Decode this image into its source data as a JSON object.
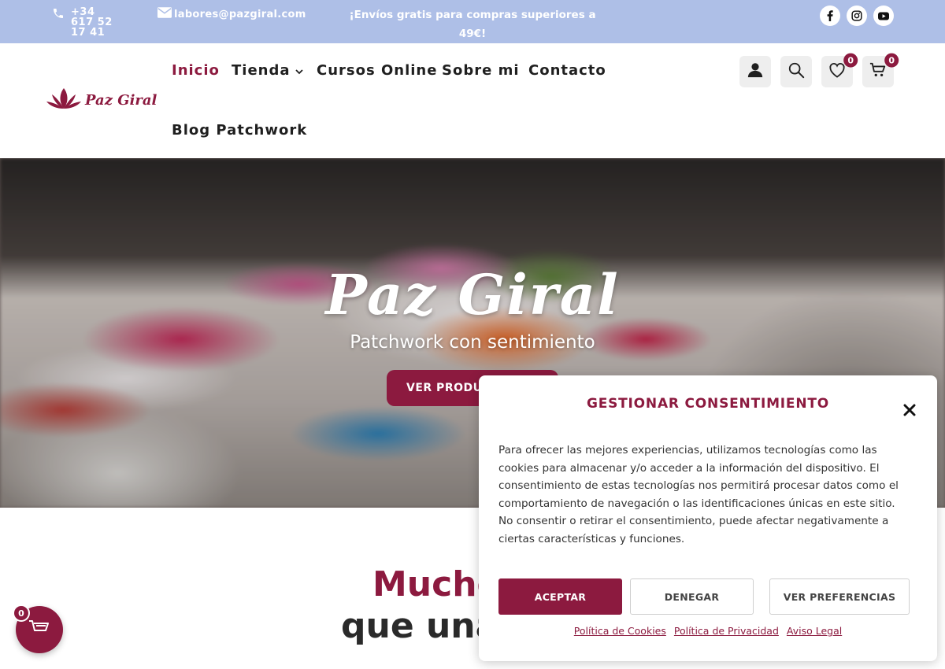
{
  "topbar": {
    "phone": "+34 617 52 17 41",
    "email": "labores@pazgiral.com",
    "promo": "¡Envíos gratis para compras superiores a 49€!",
    "social": [
      "facebook-icon",
      "instagram-icon",
      "youtube-icon"
    ]
  },
  "logo": {
    "text": "Paz Giral"
  },
  "nav": {
    "items": [
      {
        "label": "Inicio",
        "active": true
      },
      {
        "label": "Tienda",
        "dropdown": true
      },
      {
        "label": "Cursos Online"
      },
      {
        "label": "Sobre mi"
      },
      {
        "label": "Contacto"
      },
      {
        "label": "Blog Patchwork"
      }
    ]
  },
  "header_icons": {
    "wishlist_count": "0",
    "cart_count": "0"
  },
  "hero": {
    "title": "Paz Giral",
    "subtitle": "Patchwork con sentimiento",
    "button": "VER PRODUCTOS"
  },
  "section": {
    "headline_line1": "Mucho",
    "headline_line2": "que una"
  },
  "floating_cart": {
    "count": "0"
  },
  "consent": {
    "title": "GESTIONAR CONSENTIMIENTO",
    "body": "Para ofrecer las mejores experiencias, utilizamos tecnologías como las cookies para almacenar y/o acceder a la información del dispositivo. El consentimiento de estas tecnologías nos permitirá procesar datos como el comportamiento de navegación o las identificaciones únicas en este sitio. No consentir o retirar el consentimiento, puede afectar negativamente a ciertas características y funciones.",
    "accept": "ACEPTAR",
    "deny": "DENEGAR",
    "preferences": "VER PREFERENCIAS",
    "links": [
      "Política de Cookies",
      "Política de Privacidad",
      "Aviso Legal"
    ]
  },
  "colors": {
    "brand": "#8c1a3f",
    "topbar": "#aebfe7"
  }
}
